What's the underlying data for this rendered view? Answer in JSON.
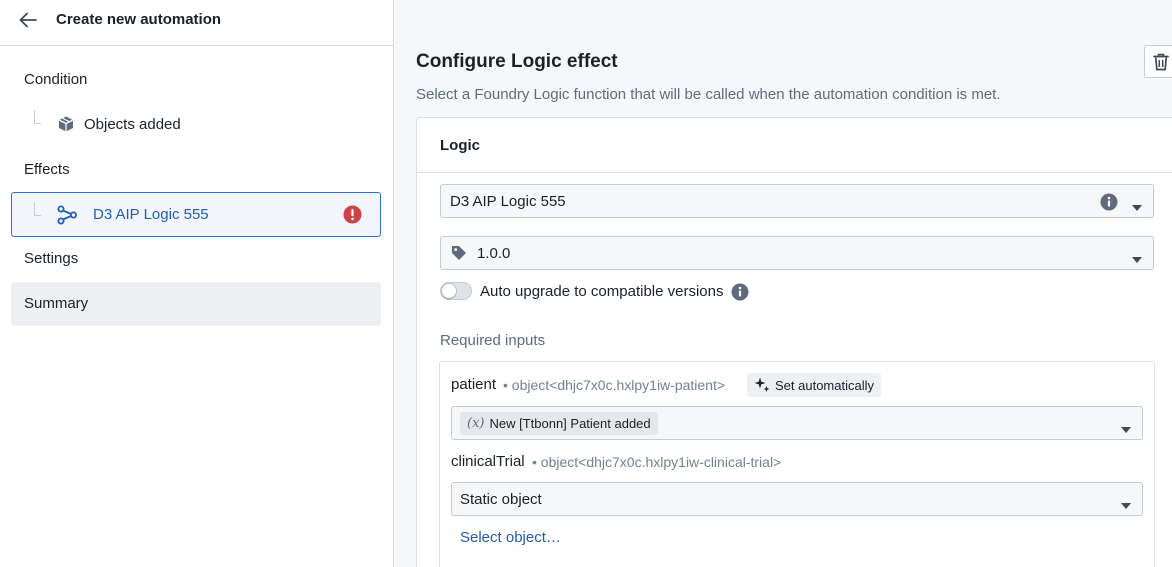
{
  "sidebar": {
    "header_title": "Create new automation",
    "condition_label": "Condition",
    "condition_item": "Objects added",
    "effects_label": "Effects",
    "effect_item": "D3 AIP Logic 555",
    "settings_label": "Settings",
    "summary_label": "Summary"
  },
  "main": {
    "title": "Configure Logic effect",
    "subtitle": "Select a Foundry Logic function that will be called when the automation condition is met.",
    "card_title": "Logic",
    "logic_select_value": "D3 AIP Logic 555",
    "version_select_value": "1.0.0",
    "auto_upgrade_label": "Auto upgrade to compatible versions",
    "auto_upgrade_enabled": false,
    "required_inputs_label": "Required inputs",
    "inputs": [
      {
        "name": "patient",
        "type": "• object<dhjc7x0c.hxlpy1iw-patient>",
        "set_auto_label": "Set automatically",
        "variable_prefix": "(x)",
        "value": "New [Ttbonn] Patient added"
      },
      {
        "name": "clinicalTrial",
        "type": "• object<dhjc7x0c.hxlpy1iw-clinical-trial>",
        "value": "Static object",
        "select_object_link": "Select object…"
      }
    ]
  },
  "icons": {
    "back": "arrow-left-icon",
    "condition_item": "cube-icon",
    "effect_item": "graph-function-icon",
    "effect_error": "error-icon",
    "trash": "trash-icon",
    "info": "info-icon",
    "version_tag": "tag-icon",
    "set_auto": "sparkle-icon",
    "caret": "caret-down-icon"
  },
  "colors": {
    "accent": "#2d72d2",
    "link": "#215db0",
    "error": "#cd4246"
  }
}
